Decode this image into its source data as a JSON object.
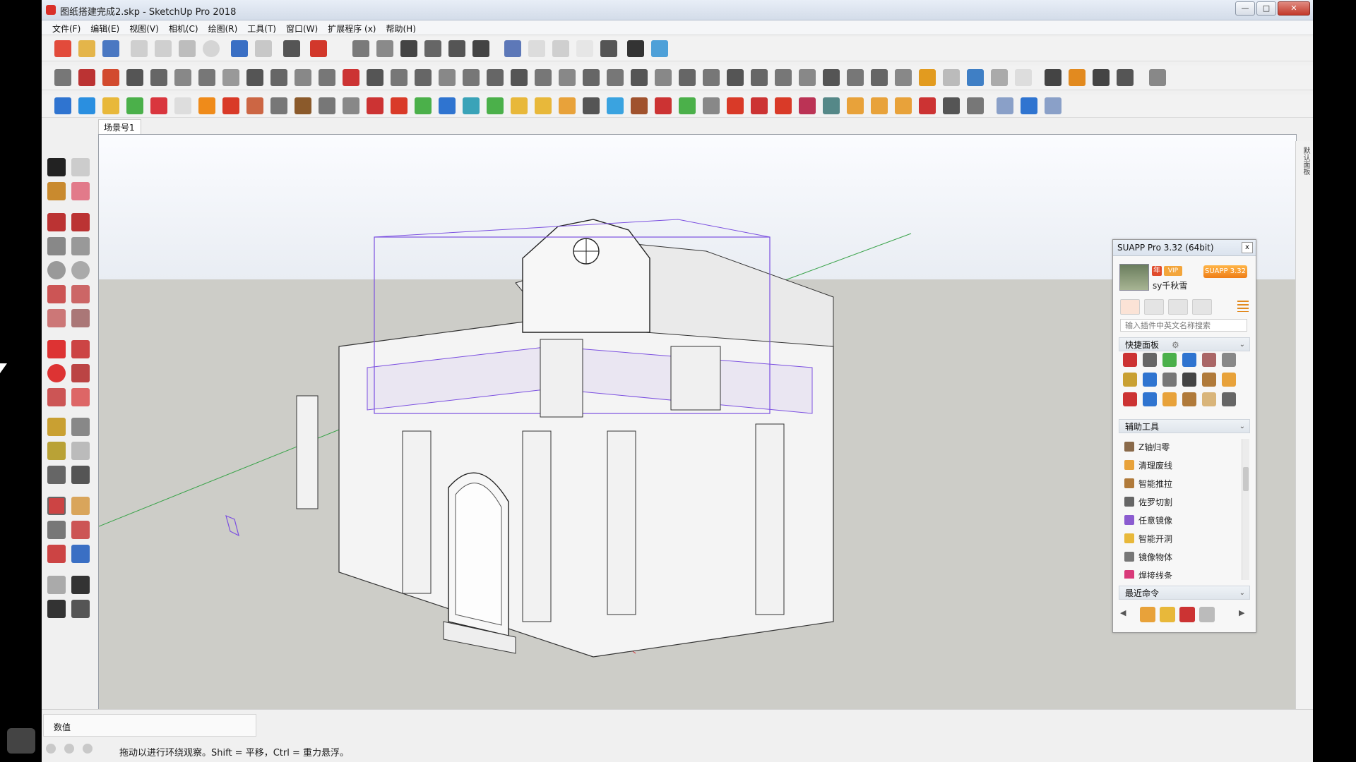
{
  "window": {
    "title": "图纸搭建完成2.skp - SketchUp Pro 2018",
    "minimize": "—",
    "maximize": "□",
    "close": "✕"
  },
  "menu": [
    "文件(F)",
    "编辑(E)",
    "视图(V)",
    "相机(C)",
    "绘图(R)",
    "工具(T)",
    "窗口(W)",
    "扩展程序 (x)",
    "帮助(H)"
  ],
  "scene_tabs": [
    "场景号1"
  ],
  "right_strip_label": "默认面板",
  "panel": {
    "title": "SUAPP Pro 3.32 (64bit)",
    "close": "x",
    "username": "sy千秋雪",
    "badge_red": "年",
    "badge_orange": "VIP",
    "version_badge": "SUAPP 3.32",
    "search_placeholder": "输入插件中英文名称搜索",
    "quick_panel": "快捷面板",
    "aux_tools": "辅助工具",
    "tools": [
      "Z轴归零",
      "清理废线",
      "智能推拉",
      "佐罗切割",
      "任意镜像",
      "智能开洞",
      "镜像物体",
      "焊接线条"
    ],
    "recent": "最近命令"
  },
  "status": {
    "measure_label": "数值",
    "hint": "拖动以进行环绕观察。Shift = 平移，Ctrl = 重力悬浮。"
  },
  "colors": {
    "accent_orange": "#ef7d17",
    "selection_purple": "#7b4fe0",
    "axis_green": "#3aa34a",
    "axis_red": "#d9363e"
  }
}
